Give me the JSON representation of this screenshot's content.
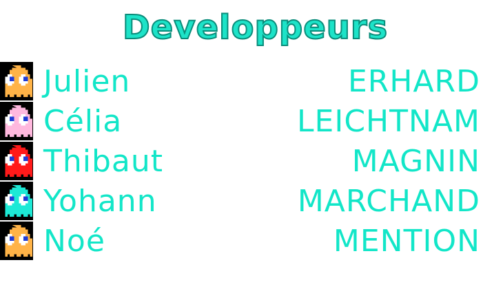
{
  "title": "Developpeurs",
  "developers": [
    {
      "first": "Julien",
      "last": "ERHARD",
      "ghost_icon": "orange-ghost-icon",
      "ghost_color": "#ffb347"
    },
    {
      "first": "Célia",
      "last": "LEICHTNAM",
      "ghost_icon": "pink-ghost-icon",
      "ghost_color": "#ffb8de"
    },
    {
      "first": "Thibaut",
      "last": "MAGNIN",
      "ghost_icon": "red-ghost-icon",
      "ghost_color": "#ff1a1a"
    },
    {
      "first": "Yohann",
      "last": "MARCHAND",
      "ghost_icon": "cyan-ghost-icon",
      "ghost_color": "#1de9d6"
    },
    {
      "first": "Noé",
      "last": "MENTION",
      "ghost_icon": "orange-ghost-icon",
      "ghost_color": "#ffb347"
    }
  ],
  "colors": {
    "text": "#12e6c8",
    "title_outline": "#0a8c7a",
    "background": "#ffffff"
  }
}
